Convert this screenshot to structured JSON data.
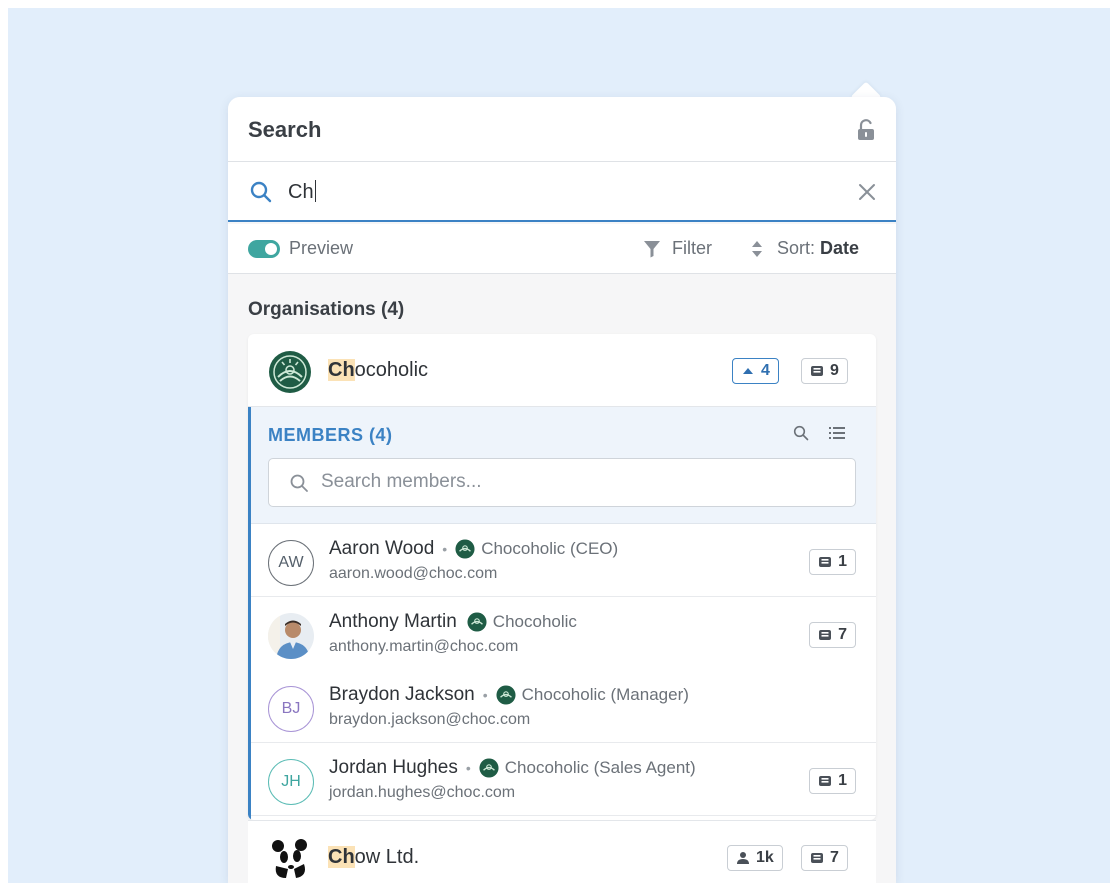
{
  "header": {
    "title": "Search",
    "lock_icon": "unlock-icon"
  },
  "search": {
    "value": "Ch",
    "clear_icon": "close-icon"
  },
  "toolbar": {
    "preview_label": "Preview",
    "preview_on": true,
    "filter_label": "Filter",
    "sort_prefix": "Sort:",
    "sort_value": "Date"
  },
  "section": {
    "title": "Organisations (4)"
  },
  "org": {
    "name_highlight": "Ch",
    "name_rest": "ocoholic",
    "up_count": "4",
    "deals_count": "9"
  },
  "members": {
    "title": "MEMBERS (4)",
    "search_placeholder": "Search members...",
    "items": [
      {
        "initials": "AW",
        "name": "Aaron Wood",
        "org": "Chocoholic (CEO)",
        "email": "aaron.wood@choc.com",
        "count": "1"
      },
      {
        "initials": "",
        "name": "Anthony Martin",
        "org": "Chocoholic",
        "email": "anthony.martin@choc.com",
        "count": "7"
      },
      {
        "initials": "BJ",
        "name": "Braydon Jackson",
        "org": "Chocoholic (Manager)",
        "email": "braydon.jackson@choc.com",
        "count": ""
      },
      {
        "initials": "JH",
        "name": "Jordan Hughes",
        "org": "Chocoholic (Sales Agent)",
        "email": "jordan.hughes@choc.com",
        "count": "1"
      }
    ]
  },
  "org2": {
    "name_highlight": "Ch",
    "name_rest": "ow Ltd.",
    "people_count": "1k",
    "deals_count": "7"
  },
  "colors": {
    "accent": "#3b82c4",
    "teal": "#3fa6a0",
    "highlight": "#fbe2b6",
    "background": "#e2eefb"
  }
}
